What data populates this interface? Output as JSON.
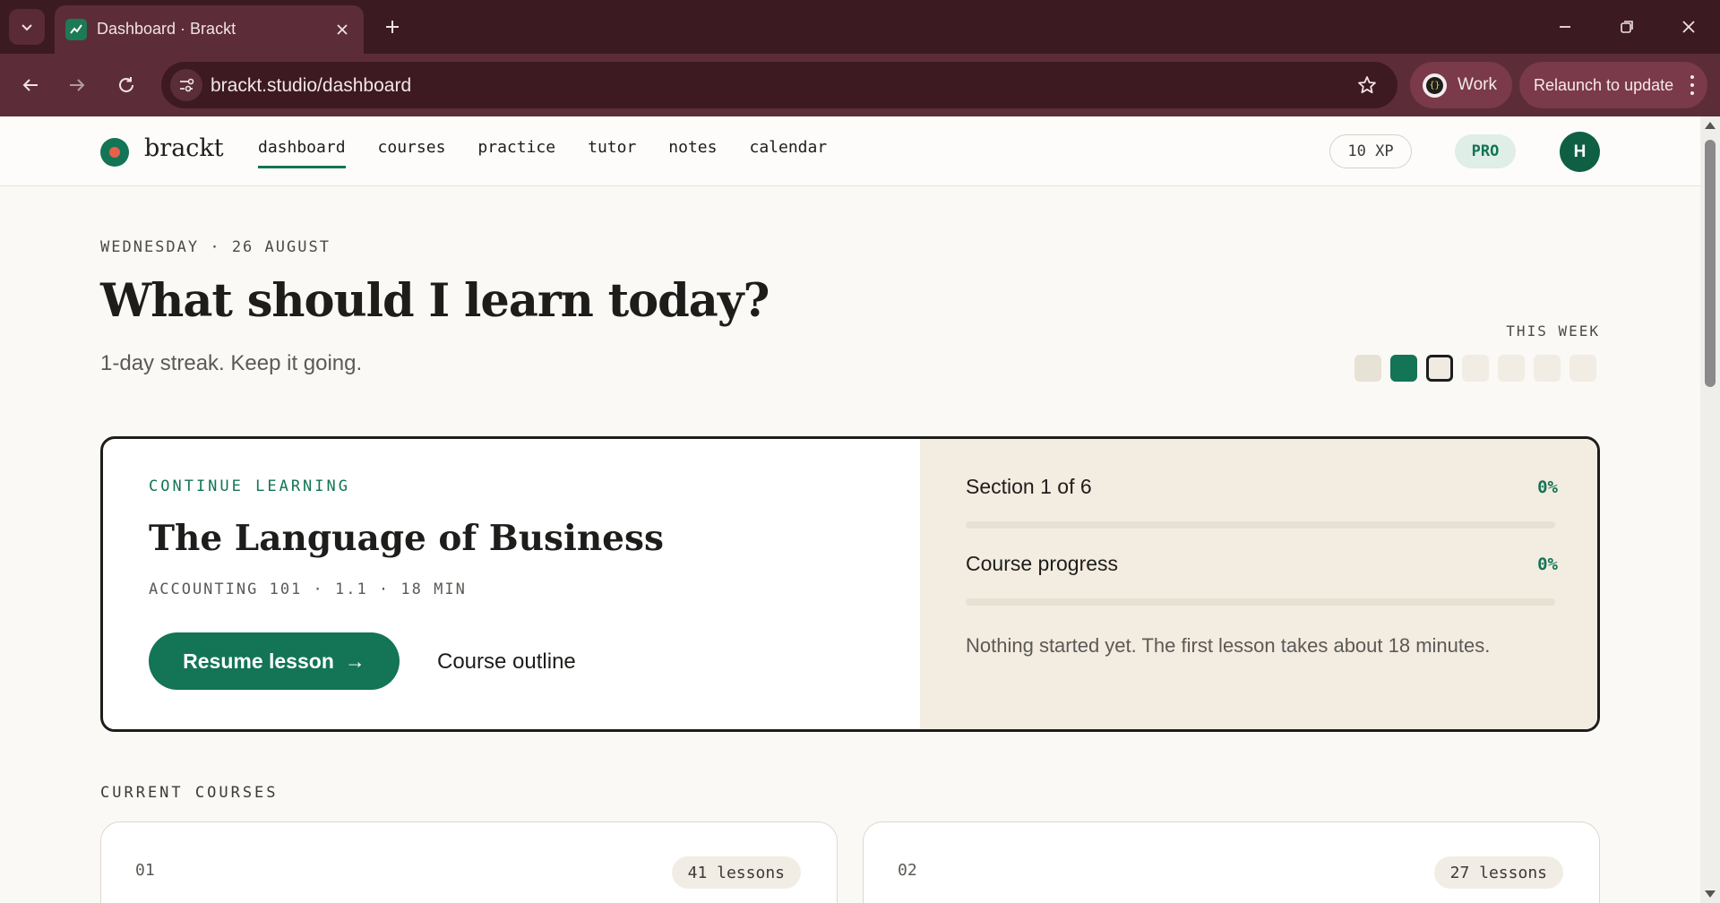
{
  "browser": {
    "tab_title": "Dashboard · Brackt",
    "url": "brackt.studio/dashboard",
    "profile_label": "Work",
    "profile_icon_text": "{}",
    "relaunch_label": "Relaunch to update",
    "icons": [
      "tab-search-icon",
      "favicon-chart-icon",
      "close-icon",
      "plus-icon",
      "minimize-icon",
      "restore-icon",
      "close-window-icon",
      "back-arrow-icon",
      "forward-arrow-icon",
      "reload-icon",
      "site-info-icon",
      "star-icon",
      "kebab-menu-icon"
    ],
    "colors": {
      "tab_bar": "#3b1a22",
      "toolbar": "#5c2d39",
      "chip": "#7a3a4a"
    }
  },
  "app": {
    "logo": "brackt",
    "nav": [
      {
        "label": "dashboard",
        "active": true
      },
      {
        "label": "courses",
        "active": false
      },
      {
        "label": "practice",
        "active": false
      },
      {
        "label": "tutor",
        "active": false
      },
      {
        "label": "notes",
        "active": false
      },
      {
        "label": "calendar",
        "active": false
      }
    ],
    "xp": "10 XP",
    "plan": "PRO",
    "avatar_initial": "H",
    "colors": {
      "accent": "#137456",
      "logo_inner": "#e8604a",
      "background": "#fbf9f5",
      "panel": "#f3ece0"
    }
  },
  "hero": {
    "date": "WEDNESDAY · 26 AUGUST",
    "headline": "What should I learn today?",
    "streak": "1-day streak. Keep it going.",
    "week_label": "THIS WEEK",
    "week_days": [
      "visited",
      "done",
      "today",
      "empty",
      "empty",
      "empty",
      "empty"
    ]
  },
  "continue": {
    "eyebrow": "CONTINUE LEARNING",
    "title": "The Language of Business",
    "meta": "ACCOUNTING 101 · 1.1 · 18 MIN",
    "resume_label": "Resume lesson",
    "resume_arrow": "→",
    "outline_label": "Course outline",
    "section_label": "Section 1 of 6",
    "section_value": "0%",
    "section_progress": 0,
    "course_label": "Course progress",
    "course_value": "0%",
    "course_progress": 0,
    "note": "Nothing started yet. The first lesson takes about 18 minutes."
  },
  "current_courses": {
    "label": "CURRENT COURSES",
    "items": [
      {
        "number": "01",
        "lessons": "41 lessons"
      },
      {
        "number": "02",
        "lessons": "27 lessons"
      }
    ]
  }
}
